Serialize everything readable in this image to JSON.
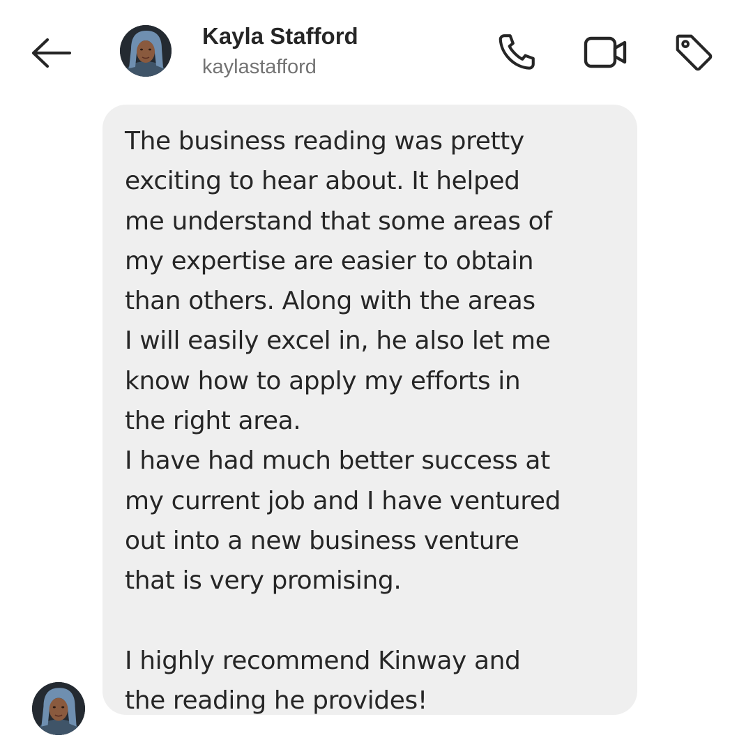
{
  "header": {
    "back_icon": "arrow-left-icon",
    "display_name": "Kayla Stafford",
    "username": "kaylastafford",
    "actions": {
      "call_icon": "phone-icon",
      "video_icon": "video-camera-icon",
      "tag_icon": "tag-icon"
    }
  },
  "message": {
    "lines": [
      "The business reading was pretty",
      "exciting to hear about. It helped",
      "me understand that some areas of",
      "my expertise are easier to obtain",
      "than others. Along with the areas",
      "I will easily excel in, he also let me",
      "know how to apply my efforts in",
      "the right area.",
      "I have had much better success at",
      "my current job and I have ventured",
      "out into a new business venture",
      "that is very promising.",
      "",
      "I highly recommend Kinway and",
      "the reading he provides!"
    ]
  },
  "colors": {
    "background": "#ffffff",
    "bubble": "#efefef",
    "text_primary": "#262626",
    "text_secondary": "#737373"
  }
}
